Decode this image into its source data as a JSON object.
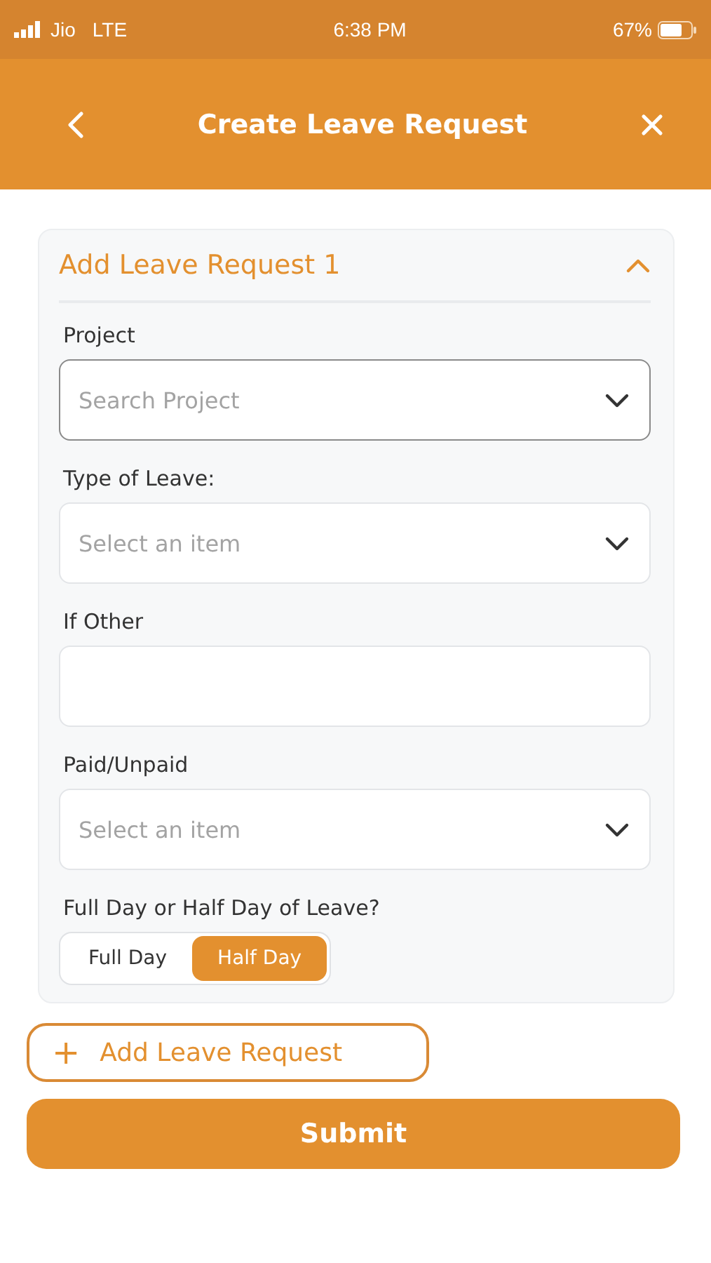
{
  "status_bar": {
    "carrier": "Jio",
    "network": "LTE",
    "time": "6:38 PM",
    "battery": "67%"
  },
  "header": {
    "title": "Create Leave Request"
  },
  "card": {
    "title": "Add Leave Request 1",
    "expanded": true,
    "fields": [
      {
        "kind": "select",
        "label": "Project",
        "placeholder": "Search Project",
        "focused": true
      },
      {
        "kind": "select",
        "label": "Type of Leave:",
        "placeholder": "Select an item",
        "focused": false
      },
      {
        "kind": "text",
        "label": "If Other",
        "focused": false
      },
      {
        "kind": "select",
        "label": "Paid/Unpaid",
        "placeholder": "Select an item",
        "focused": false
      },
      {
        "kind": "segmented",
        "label": "Full Day or Half Day of Leave?",
        "options": [
          {
            "label": "Full Day",
            "selected": false
          },
          {
            "label": "Half Day",
            "selected": true
          }
        ]
      }
    ]
  },
  "add_button": {
    "icon": "+",
    "label": "Add Leave Request"
  },
  "submit_button": {
    "label": "Submit"
  }
}
